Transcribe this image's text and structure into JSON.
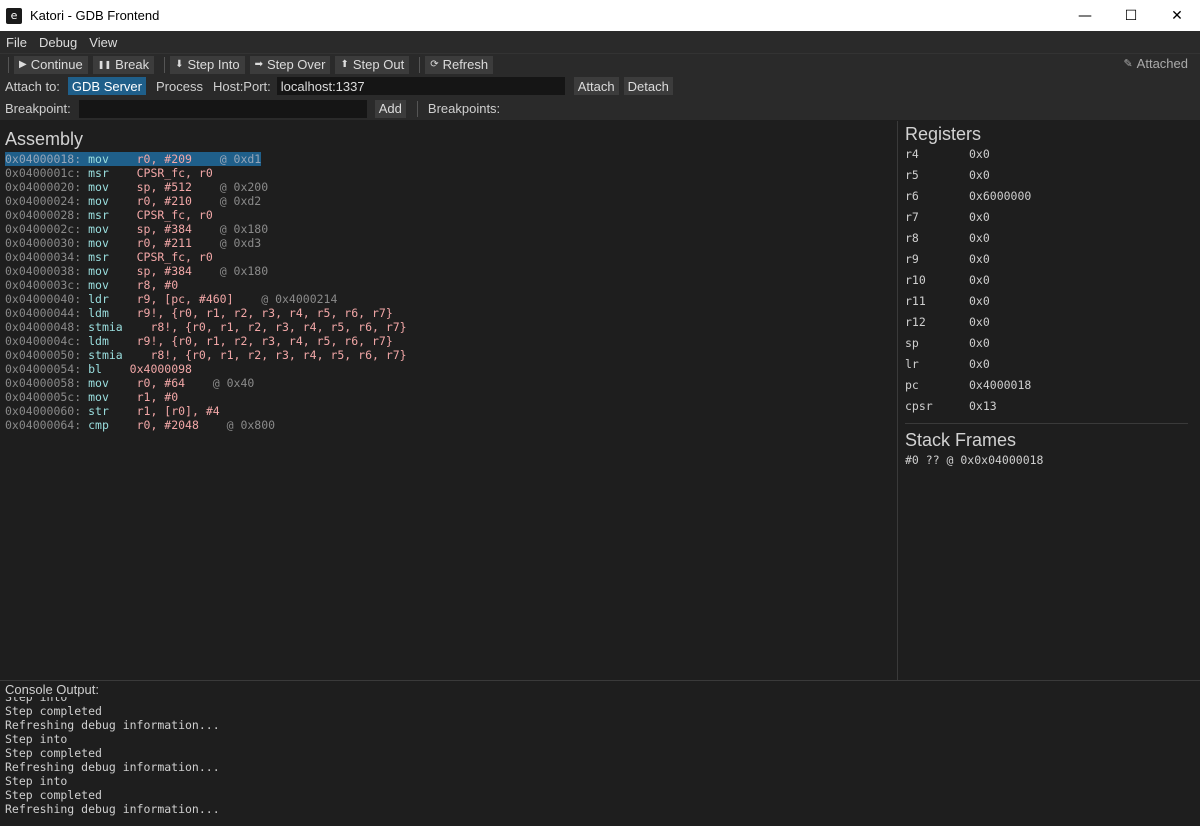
{
  "window": {
    "title": "Katori - GDB Frontend",
    "icon_glyph": "e",
    "minimize_glyph": "—",
    "maximize_glyph": "☐",
    "close_glyph": "✕"
  },
  "menu": {
    "items": [
      "File",
      "Debug",
      "View"
    ]
  },
  "toolbar": {
    "continue_label": "Continue",
    "continue_icon": "▶",
    "break_label": "Break",
    "break_icon": "❚❚",
    "step_into_label": "Step Into",
    "step_into_icon": "⬇",
    "step_over_label": "Step Over",
    "step_over_icon": "➡",
    "step_out_label": "Step Out",
    "step_out_icon": "⬆",
    "refresh_label": "Refresh",
    "refresh_icon": "⟳",
    "status_label": "Attached",
    "status_icon": "✎"
  },
  "attach": {
    "label": "Attach to:",
    "gdb_server_label": "GDB Server",
    "process_label": "Process",
    "host_label": "Host:Port:",
    "host_value": "localhost:1337",
    "attach_label": "Attach",
    "detach_label": "Detach"
  },
  "breakpoint": {
    "label": "Breakpoint:",
    "input_value": "",
    "add_label": "Add",
    "list_label": "Breakpoints:"
  },
  "assembly": {
    "title": "Assembly",
    "lines": [
      {
        "addr": "0x04000018:",
        "mn": "mov",
        "ops": "r0, #209",
        "cm": "@ 0xd1",
        "pad_m": "    ",
        "pad_c": "    "
      },
      {
        "addr": "0x0400001c:",
        "mn": "msr",
        "ops": "CPSR_fc, r0",
        "cm": "",
        "pad_m": "    ",
        "pad_c": ""
      },
      {
        "addr": "0x04000020:",
        "mn": "mov",
        "ops": "sp, #512",
        "cm": "@ 0x200",
        "pad_m": "    ",
        "pad_c": "    "
      },
      {
        "addr": "0x04000024:",
        "mn": "mov",
        "ops": "r0, #210",
        "cm": "@ 0xd2",
        "pad_m": "    ",
        "pad_c": "    "
      },
      {
        "addr": "0x04000028:",
        "mn": "msr",
        "ops": "CPSR_fc, r0",
        "cm": "",
        "pad_m": "    ",
        "pad_c": ""
      },
      {
        "addr": "0x0400002c:",
        "mn": "mov",
        "ops": "sp, #384",
        "cm": "@ 0x180",
        "pad_m": "    ",
        "pad_c": "    "
      },
      {
        "addr": "0x04000030:",
        "mn": "mov",
        "ops": "r0, #211",
        "cm": "@ 0xd3",
        "pad_m": "    ",
        "pad_c": "    "
      },
      {
        "addr": "0x04000034:",
        "mn": "msr",
        "ops": "CPSR_fc, r0",
        "cm": "",
        "pad_m": "    ",
        "pad_c": ""
      },
      {
        "addr": "0x04000038:",
        "mn": "mov",
        "ops": "sp, #384",
        "cm": "@ 0x180",
        "pad_m": "    ",
        "pad_c": "    "
      },
      {
        "addr": "0x0400003c:",
        "mn": "mov",
        "ops": "r8, #0",
        "cm": "",
        "pad_m": "    ",
        "pad_c": ""
      },
      {
        "addr": "0x04000040:",
        "mn": "ldr",
        "ops": "r9, [pc, #460]",
        "cm": "@ 0x4000214",
        "pad_m": "    ",
        "pad_c": "    "
      },
      {
        "addr": "0x04000044:",
        "mn": "ldm",
        "ops": "r9!, {r0, r1, r2, r3, r4, r5, r6, r7}",
        "cm": "",
        "pad_m": "    ",
        "pad_c": ""
      },
      {
        "addr": "0x04000048:",
        "mn": "stmia",
        "ops": "r8!, {r0, r1, r2, r3, r4, r5, r6, r7}",
        "cm": "",
        "pad_m": "    ",
        "pad_c": ""
      },
      {
        "addr": "0x0400004c:",
        "mn": "ldm",
        "ops": "r9!, {r0, r1, r2, r3, r4, r5, r6, r7}",
        "cm": "",
        "pad_m": "    ",
        "pad_c": ""
      },
      {
        "addr": "0x04000050:",
        "mn": "stmia",
        "ops": "r8!, {r0, r1, r2, r3, r4, r5, r6, r7}",
        "cm": "",
        "pad_m": "    ",
        "pad_c": ""
      },
      {
        "addr": "0x04000054:",
        "mn": "bl",
        "ops": "0x4000098",
        "cm": "",
        "pad_m": "    ",
        "pad_c": ""
      },
      {
        "addr": "0x04000058:",
        "mn": "mov",
        "ops": "r0, #64",
        "cm": "@ 0x40",
        "pad_m": "    ",
        "pad_c": "    "
      },
      {
        "addr": "0x0400005c:",
        "mn": "mov",
        "ops": "r1, #0",
        "cm": "",
        "pad_m": "    ",
        "pad_c": ""
      },
      {
        "addr": "0x04000060:",
        "mn": "str",
        "ops": "r1, [r0], #4",
        "cm": "",
        "pad_m": "    ",
        "pad_c": ""
      },
      {
        "addr": "0x04000064:",
        "mn": "cmp",
        "ops": "r0, #2048",
        "cm": "@ 0x800",
        "pad_m": "    ",
        "pad_c": "    "
      }
    ]
  },
  "registers": {
    "title": "Registers",
    "rows": [
      {
        "name": "r4",
        "value": "0x0"
      },
      {
        "name": "r5",
        "value": "0x0"
      },
      {
        "name": "r6",
        "value": "0x6000000"
      },
      {
        "name": "r7",
        "value": "0x0"
      },
      {
        "name": "r8",
        "value": "0x0"
      },
      {
        "name": "r9",
        "value": "0x0"
      },
      {
        "name": "r10",
        "value": "0x0"
      },
      {
        "name": "r11",
        "value": "0x0"
      },
      {
        "name": "r12",
        "value": "0x0"
      },
      {
        "name": "sp",
        "value": "0x0"
      },
      {
        "name": "lr",
        "value": "0x0"
      },
      {
        "name": "pc",
        "value": "0x4000018"
      },
      {
        "name": "cpsr",
        "value": "0x13"
      }
    ]
  },
  "stack": {
    "title": "Stack Frames",
    "frames": [
      "#0 ?? @ 0x0x04000018"
    ]
  },
  "console": {
    "title": "Console Output:",
    "lines": [
      "Step into",
      "Step completed",
      "Refreshing debug information...",
      "Step into",
      "Step completed",
      "Refreshing debug information...",
      "Step into",
      "Step completed",
      "Refreshing debug information..."
    ]
  },
  "colors": {
    "accent": "#1f5f8a",
    "background": "#1e1e1e",
    "toolbar": "#2a2a2a",
    "mnemonic": "#9adede",
    "operand": "#f2a7a7",
    "comment": "#8a8a8a"
  }
}
